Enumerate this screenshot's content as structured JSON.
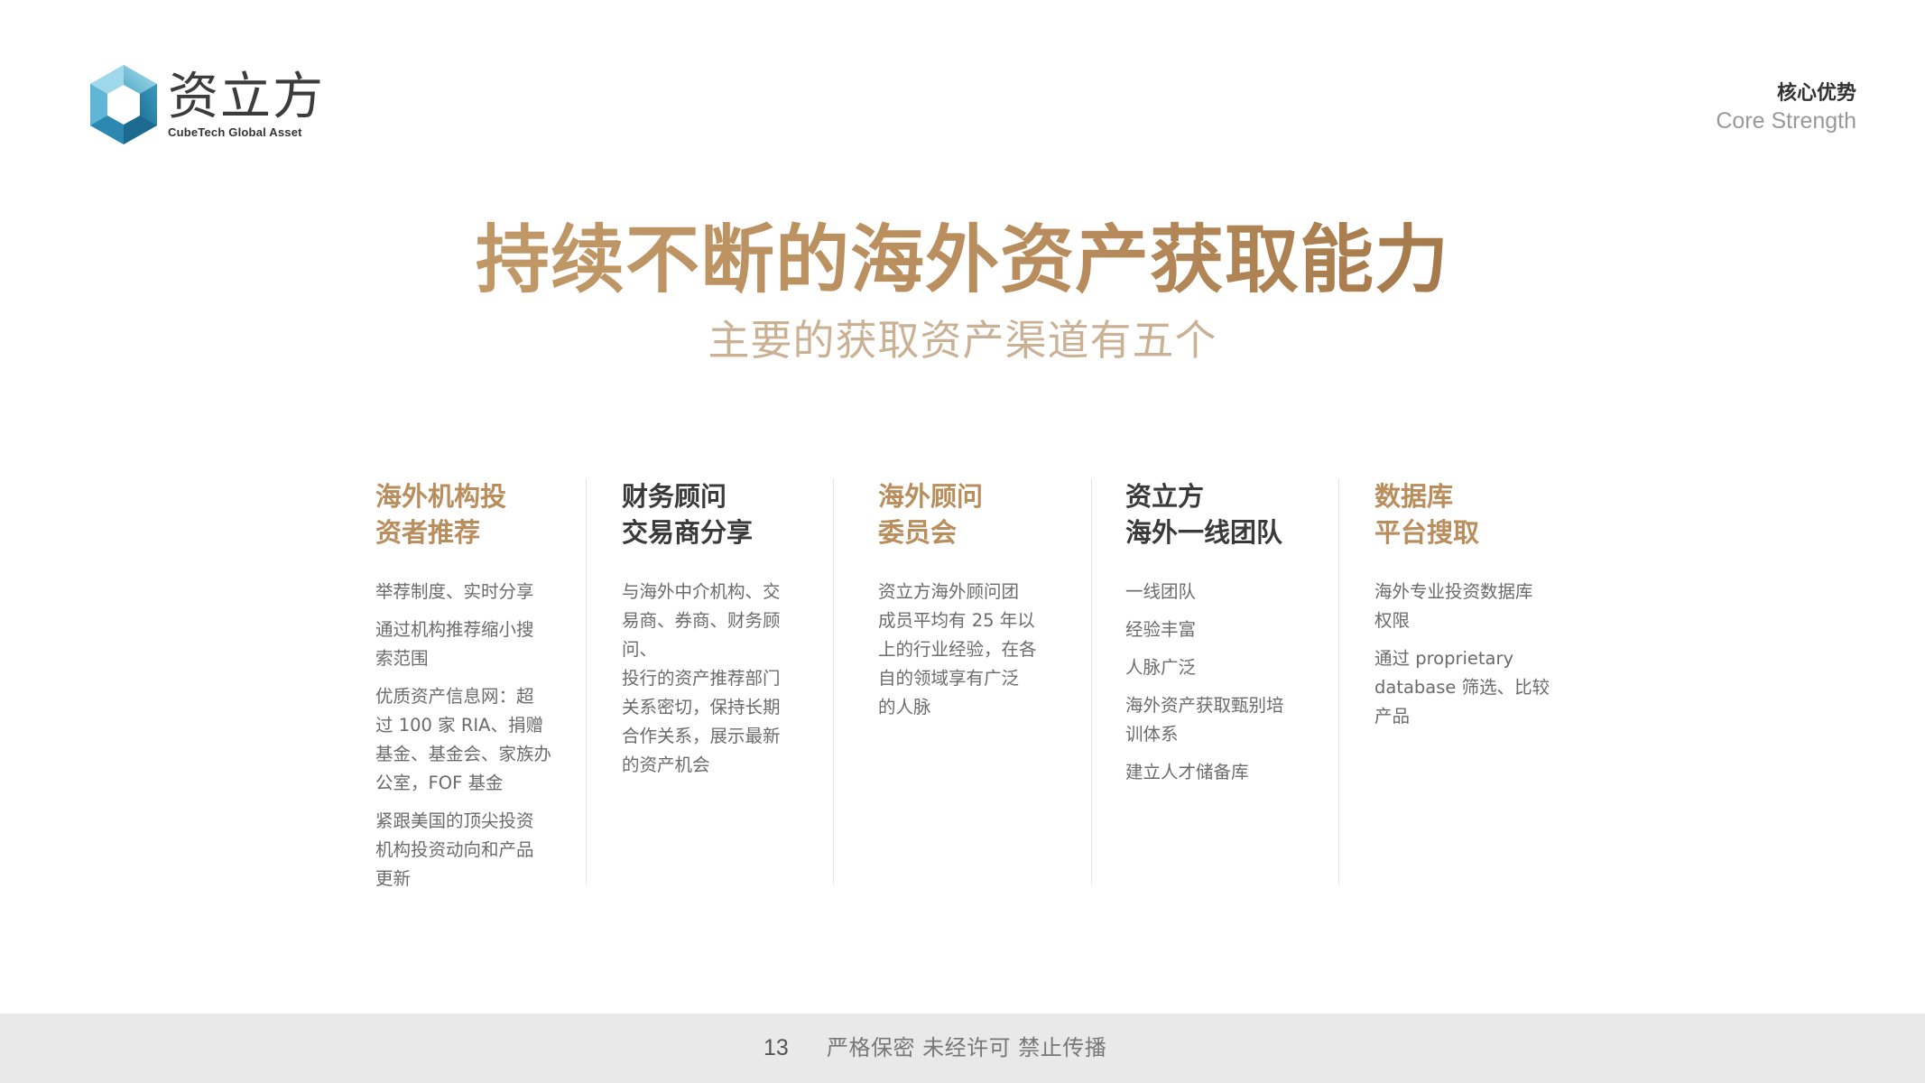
{
  "logo": {
    "name_cn": "资立方",
    "name_en": "CubeTech Global Asset"
  },
  "section": {
    "title_cn": "核心优势",
    "title_en": "Core Strength"
  },
  "main_title": "持续不断的海外资产获取能力",
  "subtitle": "主要的获取资产渠道有五个",
  "columns": [
    {
      "title": "海外机构投\n资者推荐",
      "accent": "gold",
      "items": [
        "举荐制度、实时分享",
        "通过机构推荐缩小搜\n索范围",
        "优质资产信息网：超\n过 100 家 RIA、捐赠\n基金、基金会、家族办\n公室，FOF 基金",
        "紧跟美国的顶尖投资\n机构投资动向和产品\n更新"
      ]
    },
    {
      "title": "财务顾问\n交易商分享",
      "accent": "dark",
      "items": [
        "与海外中介机构、交\n易商、券商、财务顾问、\n投行的资产推荐部门\n关系密切，保持长期\n合作关系，展示最新\n的资产机会"
      ]
    },
    {
      "title": "海外顾问\n委员会",
      "accent": "gold",
      "items": [
        "资立方海外顾问团\n成员平均有 25 年以\n上的行业经验，在各\n自的领域享有广泛\n的人脉"
      ]
    },
    {
      "title": "资立方\n海外一线团队",
      "accent": "dark",
      "items": [
        "一线团队",
        "经验丰富",
        "人脉广泛",
        "海外资产获取甄别培\n训体系",
        "建立人才储备库"
      ]
    },
    {
      "title": "数据库\n平台搜取",
      "accent": "gold",
      "items": [
        "海外专业投资数据库\n权限",
        "通过 proprietary\ndatabase 筛选、比较\n产品"
      ]
    }
  ],
  "footer": {
    "page_number": "13",
    "notice": "严格保密 未经许可 禁止传播"
  },
  "colors": {
    "gold": "#b98d5c",
    "dark": "#3a3a3a",
    "body": "#6b6b6b",
    "subtitle": "#cbb194",
    "footer_bg": "#e9e9e9",
    "logo_teal": "#3aa3c4"
  }
}
